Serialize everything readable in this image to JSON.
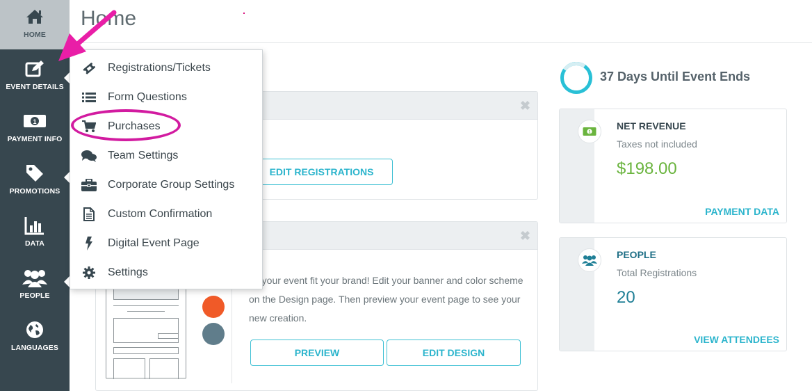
{
  "page": {
    "title": "Home"
  },
  "sidebar": {
    "items": [
      {
        "label": "HOME",
        "icon": "home-icon"
      },
      {
        "label": "EVENT DETAILS",
        "icon": "edit-icon"
      },
      {
        "label": "PAYMENT INFO",
        "icon": "money-icon"
      },
      {
        "label": "PROMOTIONS",
        "icon": "tag-icon"
      },
      {
        "label": "DATA",
        "icon": "bar-chart-icon"
      },
      {
        "label": "PEOPLE",
        "icon": "people-icon"
      },
      {
        "label": "LANGUAGES",
        "icon": "globe-icon"
      }
    ]
  },
  "menu": {
    "items": [
      {
        "label": "Registrations/Tickets",
        "icon": "ticket-icon"
      },
      {
        "label": "Form Questions",
        "icon": "list-icon"
      },
      {
        "label": "Purchases",
        "icon": "cart-icon"
      },
      {
        "label": "Team Settings",
        "icon": "comments-icon"
      },
      {
        "label": "Corporate Group Settings",
        "icon": "briefcase-icon"
      },
      {
        "label": "Custom Confirmation",
        "icon": "document-icon"
      },
      {
        "label": "Digital Event Page",
        "icon": "bolt-icon"
      },
      {
        "label": "Settings",
        "icon": "gear-icon"
      }
    ]
  },
  "registrations_card": {
    "button_label": "EDIT REGISTRATIONS",
    "close_glyph": "✖"
  },
  "design_card": {
    "description": "ke your event fit your brand! Edit your banner and color scheme on the Design page. Then preview your event page to see your new creation.",
    "preview_label": "PREVIEW",
    "edit_design_label": "EDIT DESIGN",
    "close_glyph": "✖",
    "swatch_colors": [
      "#f05a28",
      "#607d8b"
    ]
  },
  "countdown": {
    "text": "37 Days Until Event Ends"
  },
  "revenue": {
    "title": "NET REVENUE",
    "subtitle": "Taxes not included",
    "value": "$198.00",
    "link": "PAYMENT DATA",
    "value_color": "#6ab43e"
  },
  "people": {
    "title": "PEOPLE",
    "subtitle": "Total Registrations",
    "value": "20",
    "link": "VIEW ATTENDEES",
    "value_color": "#1f7f96"
  },
  "colors": {
    "sidebar_bg": "#37474f",
    "accent": "#2bb4cc",
    "annotation": "#d21ba0"
  }
}
